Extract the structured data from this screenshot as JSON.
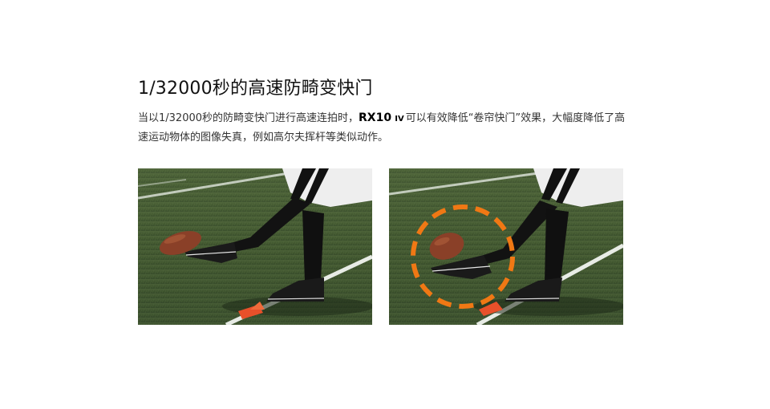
{
  "feature": {
    "title": "1/32000秒的高速防畸变快门",
    "desc_before": "当以1/32000秒的防畸变快门进行高速连拍时，",
    "model": "RX10",
    "model_suffix": "IV",
    "desc_after": "可以有效降低“卷帘快门”效果，大幅度降低了高速运动物体的图像失真，例如高尔夫挥杆等类似动作。"
  },
  "photos": [
    {
      "name": "kick-photo-standard",
      "highlight": false
    },
    {
      "name": "kick-photo-highlighted",
      "highlight": true,
      "highlight_color": "#f07814"
    }
  ],
  "colors": {
    "grass": "#3f5530",
    "grass_dark": "#2c3d22",
    "yard_line": "#e8ece6",
    "ball": "#8a4028",
    "tee": "#e8502a",
    "uniform": "#eeeeee",
    "sock": "#111111"
  }
}
